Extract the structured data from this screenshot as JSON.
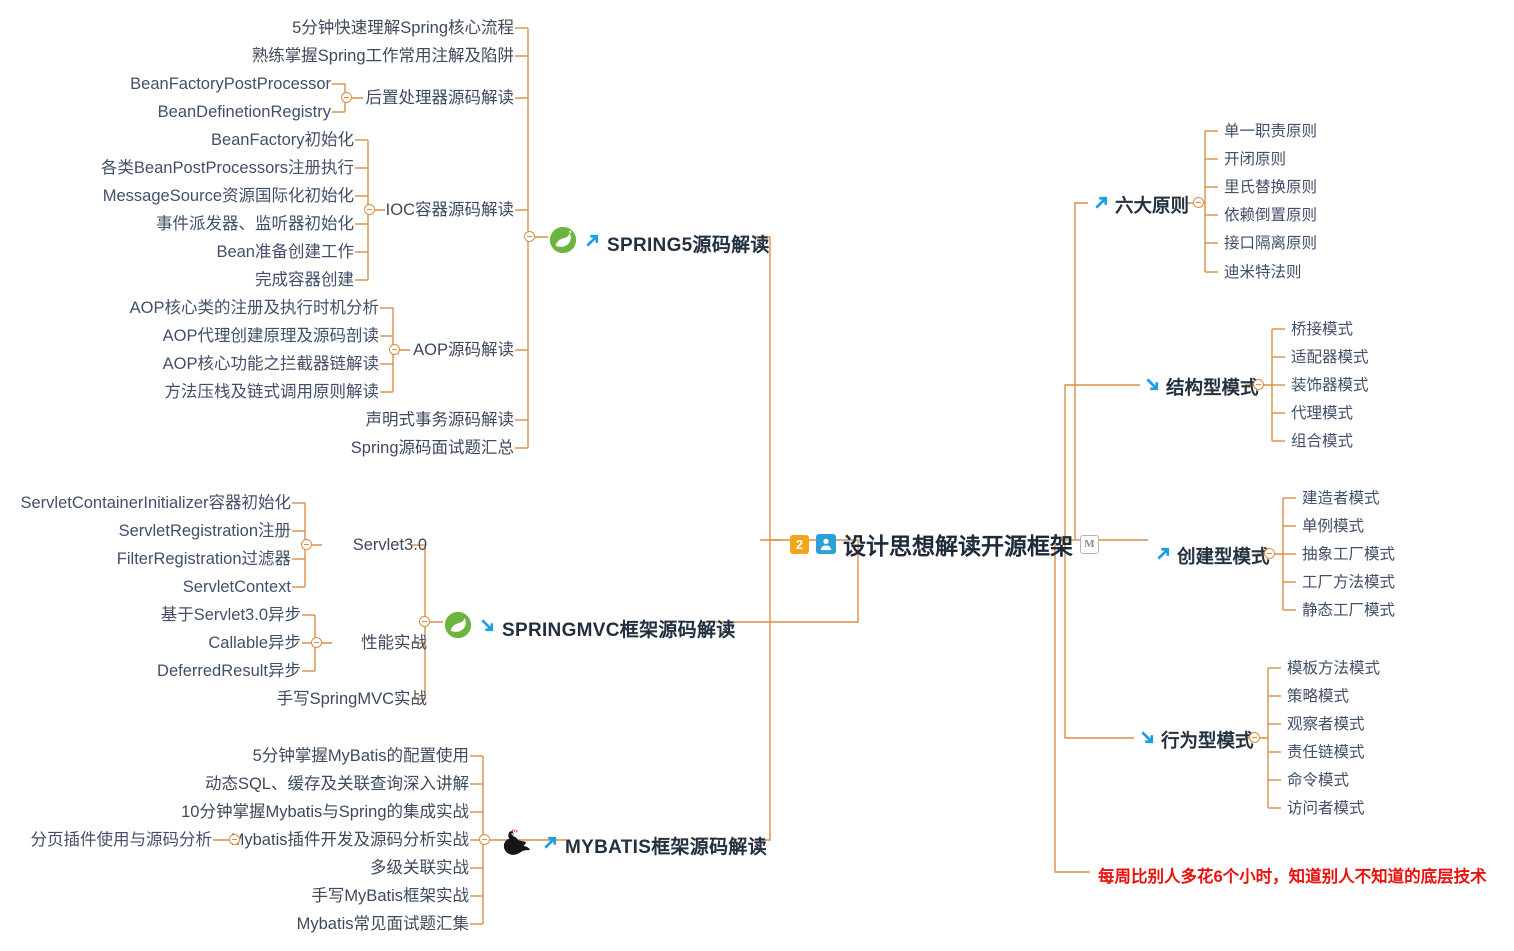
{
  "center": {
    "badge_number": "2",
    "user_icon": "user-icon",
    "title": "设计思想解读开源框架",
    "badge_mark": "M"
  },
  "promo": "每周比别人多花6个小时，知道别人不知道的底层技术",
  "colors": {
    "connector": "#d98e46",
    "text": "#3d4a5c",
    "title": "#22303f",
    "promo": "#e8130f",
    "badge_orange": "#f2a61e",
    "badge_blue": "#2a9fd8",
    "spring_green": "#6db33f",
    "arrow_blue": "#1e9fe0"
  },
  "left_branches": [
    {
      "id": "spring5",
      "label": "SPRING5源码解读",
      "logo": "spring-leaf-icon",
      "arrow": "arrow-up-right-icon",
      "groups": [
        {
          "id": "s-direct-1",
          "label": "5分钟快速理解Spring核心流程",
          "children": []
        },
        {
          "id": "s-direct-2",
          "label": "熟练掌握Spring工作常用注解及陷阱",
          "children": []
        },
        {
          "id": "s-post",
          "label": "后置处理器源码解读",
          "children": [
            "BeanFactoryPostProcessor",
            "BeanDefinetionRegistry"
          ]
        },
        {
          "id": "s-ioc",
          "label": "IOC容器源码解读",
          "children": [
            "BeanFactory初始化",
            "各类BeanPostProcessors注册执行",
            "MessageSource资源国际化初始化",
            "事件派发器、监听器初始化",
            "Bean准备创建工作",
            "完成容器创建"
          ]
        },
        {
          "id": "s-aop",
          "label": "AOP源码解读",
          "children": [
            "AOP核心类的注册及执行时机分析",
            "AOP代理创建原理及源码剖读",
            "AOP核心功能之拦截器链解读",
            "方法压栈及链式调用原则解读"
          ]
        },
        {
          "id": "s-direct-3",
          "label": "声明式事务源码解读",
          "children": []
        },
        {
          "id": "s-direct-4",
          "label": "Spring源码面试题汇总",
          "children": []
        }
      ]
    },
    {
      "id": "springmvc",
      "label": "SPRINGMVC框架源码解读",
      "logo": "spring-leaf-icon",
      "arrow": "arrow-down-right-icon",
      "groups": [
        {
          "id": "m-servlet",
          "label": "Servlet3.0",
          "children": [
            "ServletContainerInitializer容器初始化",
            "ServletRegistration注册",
            "FilterRegistration过滤器",
            "ServletContext"
          ]
        },
        {
          "id": "m-perf",
          "label": "性能实战",
          "children": [
            "基于Servlet3.0异步",
            "Callable异步",
            "DeferredResult异步"
          ]
        },
        {
          "id": "m-direct-1",
          "label": "手写SpringMVC实战",
          "children": []
        }
      ]
    },
    {
      "id": "mybatis",
      "label": "MYBATIS框架源码解读",
      "logo": "mybatis-bird-icon",
      "arrow": "arrow-up-right-icon",
      "groups": [
        {
          "id": "b-1",
          "label": "5分钟掌握MyBatis的配置使用",
          "children": []
        },
        {
          "id": "b-2",
          "label": "动态SQL、缓存及关联查询深入讲解",
          "children": []
        },
        {
          "id": "b-3",
          "label": "10分钟掌握Mybatis与Spring的集成实战",
          "children": []
        },
        {
          "id": "b-4",
          "label": "Mybatis插件开发及源码分析实战",
          "children": [
            "分页插件使用与源码分析"
          ]
        },
        {
          "id": "b-5",
          "label": "多级关联实战",
          "children": []
        },
        {
          "id": "b-6",
          "label": "手写MyBatis框架实战",
          "children": []
        },
        {
          "id": "b-7",
          "label": "Mybatis常见面试题汇集",
          "children": []
        }
      ]
    }
  ],
  "right_branches": [
    {
      "id": "six",
      "label": "六大原则",
      "arrow": "arrow-up-right-icon",
      "children": [
        "单一职责原则",
        "开闭原则",
        "里氏替换原则",
        "依赖倒置原则",
        "接口隔离原则",
        "迪米特法则"
      ]
    },
    {
      "id": "struct",
      "label": "结构型模式",
      "arrow": "arrow-down-right-icon",
      "children": [
        "桥接模式",
        "适配器模式",
        "装饰器模式",
        "代理模式",
        "组合模式"
      ]
    },
    {
      "id": "create",
      "label": "创建型模式",
      "arrow": "arrow-up-right-icon",
      "children": [
        "建造者模式",
        "单例模式",
        "抽象工厂模式",
        "工厂方法模式",
        "静态工厂模式"
      ]
    },
    {
      "id": "behav",
      "label": "行为型模式",
      "arrow": "arrow-down-right-icon",
      "children": [
        "模板方法模式",
        "策略模式",
        "观察者模式",
        "责任链模式",
        "命令模式",
        "访问者模式"
      ]
    }
  ]
}
